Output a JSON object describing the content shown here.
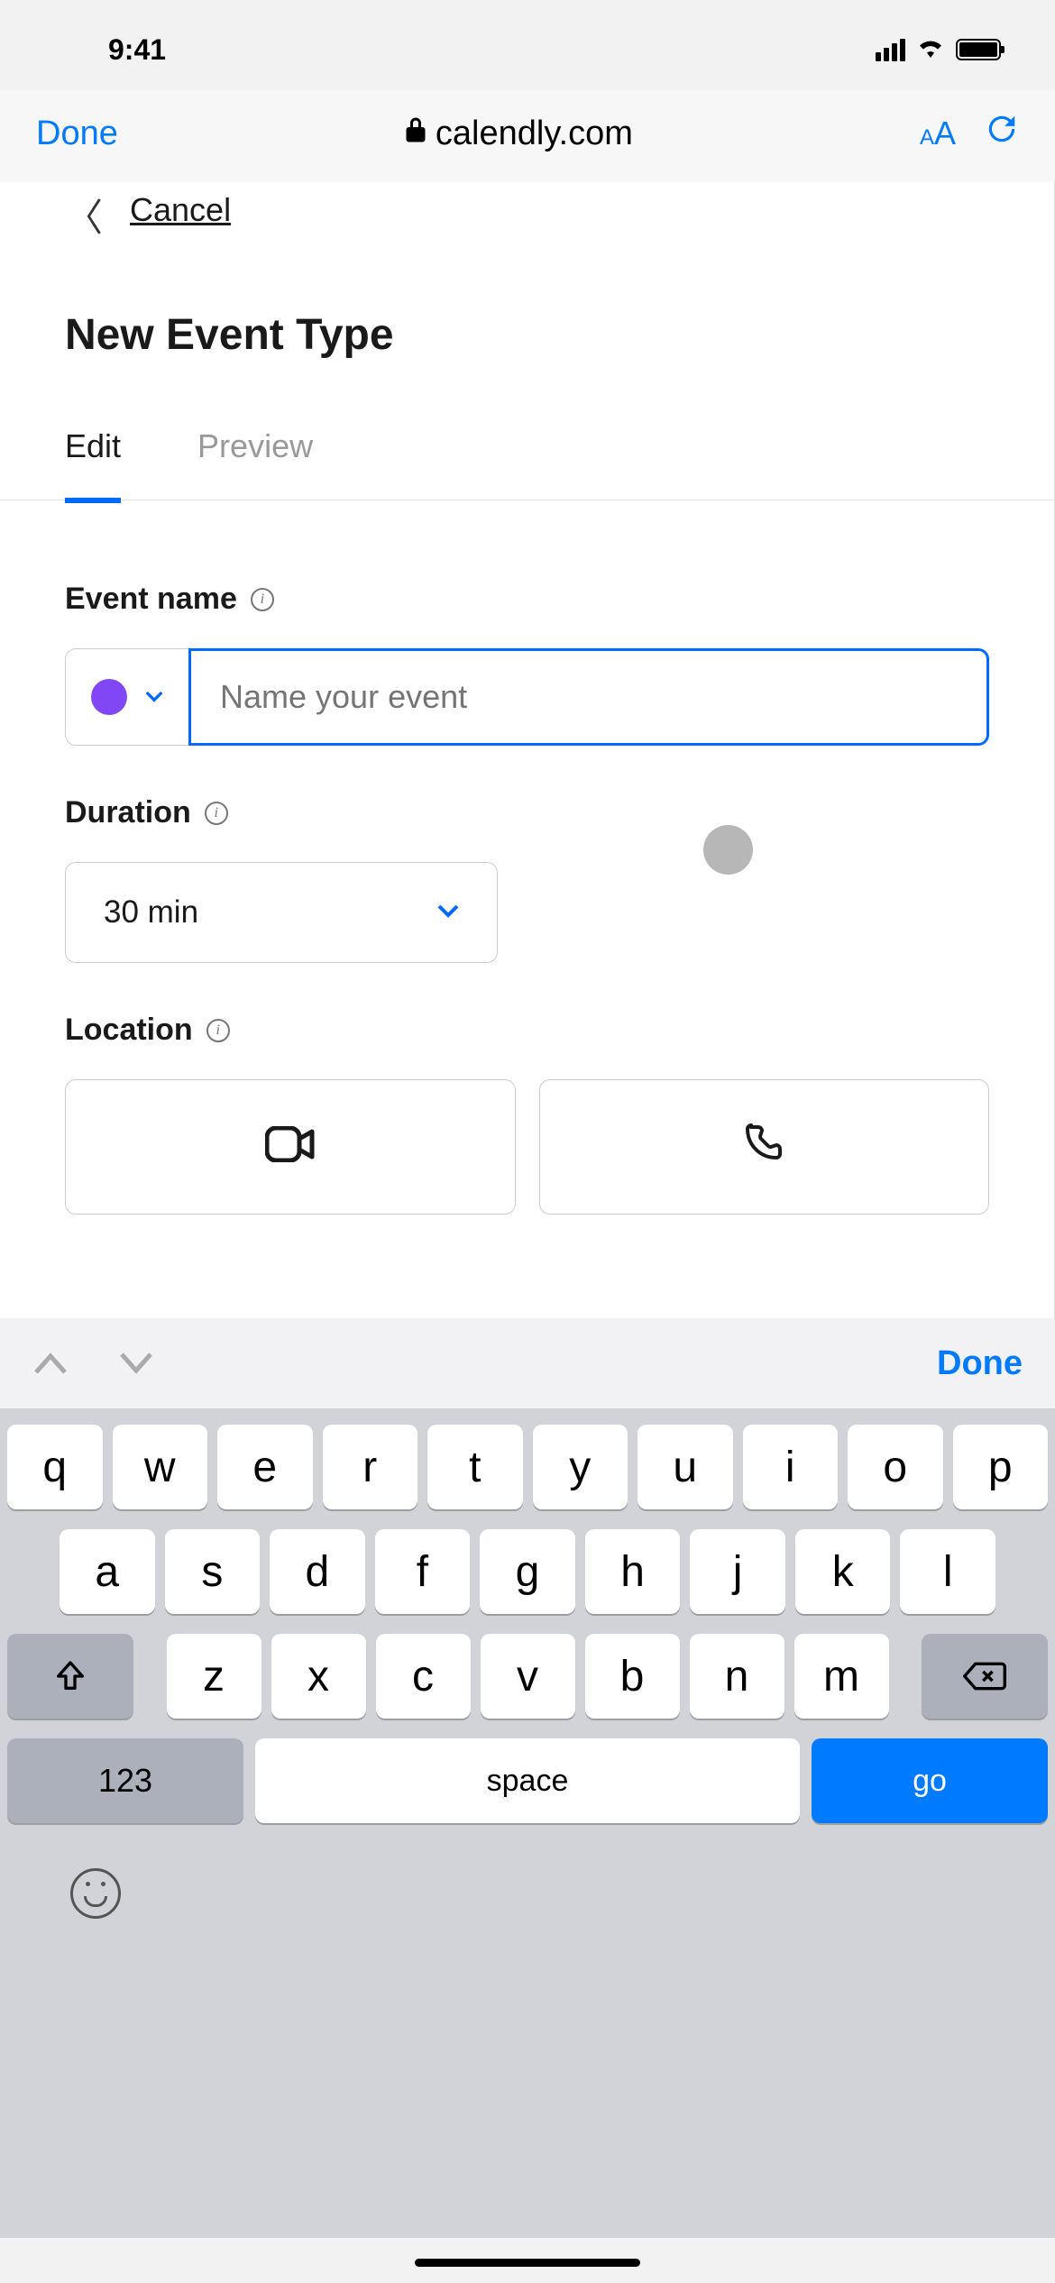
{
  "statusBar": {
    "time": "9:41"
  },
  "browser": {
    "done": "Done",
    "url": "calendly.com"
  },
  "page": {
    "cancel": "Cancel",
    "title": "New Event Type",
    "tabs": {
      "edit": "Edit",
      "preview": "Preview"
    },
    "fields": {
      "eventName": {
        "label": "Event name",
        "placeholder": "Name your event",
        "color": "#8247f5"
      },
      "duration": {
        "label": "Duration",
        "value": "30 min"
      },
      "location": {
        "label": "Location"
      }
    }
  },
  "keyboard": {
    "accessoryDone": "Done",
    "row1": [
      "q",
      "w",
      "e",
      "r",
      "t",
      "y",
      "u",
      "i",
      "o",
      "p"
    ],
    "row2": [
      "a",
      "s",
      "d",
      "f",
      "g",
      "h",
      "j",
      "k",
      "l"
    ],
    "row3": [
      "z",
      "x",
      "c",
      "v",
      "b",
      "n",
      "m"
    ],
    "numKey": "123",
    "spaceKey": "space",
    "goKey": "go"
  }
}
